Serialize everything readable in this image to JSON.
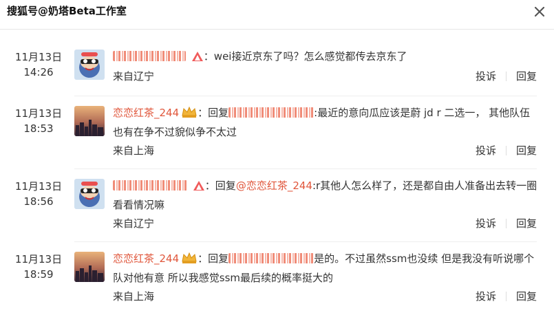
{
  "header": {
    "title": "搜狐号@奶塔Beta工作室",
    "close_icon": "close-icon"
  },
  "comments": [
    {
      "date": "11月13日",
      "time": "14:26",
      "avatar": "cartoon-avatar",
      "nickname_masked": true,
      "badge": "red-triangle-badge",
      "text": "wei接近京东了吗？怎么感觉都传去京东了",
      "from": "来自辽宁",
      "report_label": "投诉",
      "reply_label": "回复"
    },
    {
      "date": "11月13日",
      "time": "18:53",
      "avatar": "city-skyline-avatar",
      "nickname": "恋恋红茶_244",
      "badge": "gold-crown-badge",
      "reply_prefix": "回复",
      "text": "最近的意向瓜应该是蔚 jd r 二选一， 其他队伍也有在争不过貌似争不太过",
      "from": "来自上海",
      "report_label": "投诉",
      "reply_label": "回复"
    },
    {
      "date": "11月13日",
      "time": "18:56",
      "avatar": "cartoon-avatar",
      "nickname_masked": true,
      "badge": "red-triangle-badge",
      "reply_prefix": "回复",
      "reply_target": "@恋恋红茶_244",
      "text": ":r其他人怎么样了，还是都自由人准备出去转一圈看看情况嘛",
      "from": "来自辽宁",
      "report_label": "投诉",
      "reply_label": "回复"
    },
    {
      "date": "11月13日",
      "time": "18:59",
      "avatar": "city-skyline-avatar",
      "nickname": "恋恋红茶_244",
      "badge": "gold-crown-badge",
      "reply_prefix": "回复",
      "text": "是的。不过虽然ssm也没续 但是我没有听说哪个队对他有意 所以我感觉ssm最后续的概率挺大的",
      "from": "来自上海",
      "report_label": "投诉",
      "reply_label": "回复"
    }
  ]
}
